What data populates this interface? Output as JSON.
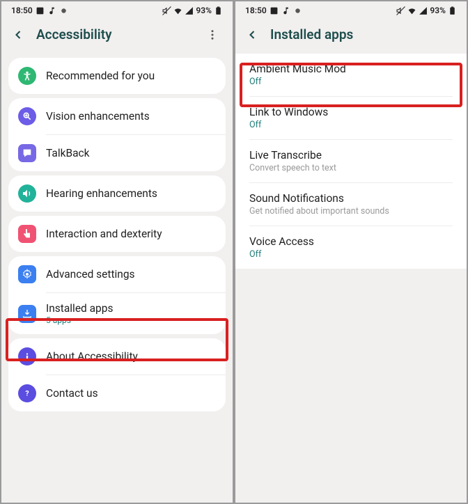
{
  "status": {
    "time": "18:50",
    "battery": "93%"
  },
  "left": {
    "title": "Accessibility",
    "recommended": "Recommended for you",
    "vision": "Vision enhancements",
    "talkback": "TalkBack",
    "hearing": "Hearing enhancements",
    "interaction": "Interaction and dexterity",
    "advanced": "Advanced settings",
    "installed": "Installed apps",
    "installed_sub": "5 apps",
    "about": "About Accessibility",
    "contact": "Contact us"
  },
  "right": {
    "title": "Installed apps",
    "items": [
      {
        "label": "Ambient Music Mod",
        "sub": "Off",
        "sub_type": "off"
      },
      {
        "label": "Link to Windows",
        "sub": "Off",
        "sub_type": "off"
      },
      {
        "label": "Live Transcribe",
        "sub": "Convert speech to text",
        "sub_type": "grey"
      },
      {
        "label": "Sound Notifications",
        "sub": "Get notified about important sounds",
        "sub_type": "grey"
      },
      {
        "label": "Voice Access",
        "sub": "Off",
        "sub_type": "off"
      }
    ]
  }
}
